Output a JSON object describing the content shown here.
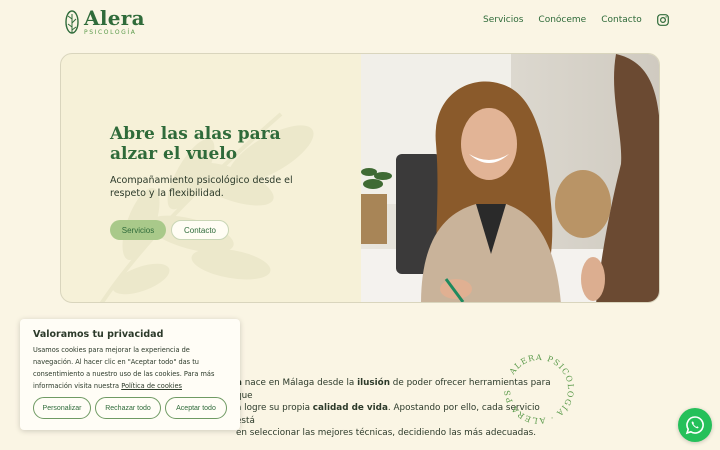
{
  "brand": {
    "name": "Alera",
    "tagline": "PSICOLOGÍA"
  },
  "nav": {
    "items": [
      {
        "label": "Servicios"
      },
      {
        "label": "Conóceme"
      },
      {
        "label": "Contacto"
      }
    ],
    "instagram_icon": "instagram-icon"
  },
  "hero": {
    "title_line1": "Abre las alas para",
    "title_line2": "alzar el vuelo",
    "subtitle": "Acompañamiento psicológico desde el respeto y la flexibilidad.",
    "primary_button": "Servicios",
    "secondary_button": "Contacto"
  },
  "intro": {
    "part1_bold": "a",
    "part2": " nace en Málaga desde la ",
    "part3_bold": "ilusión",
    "part4": " de poder ofrecer herramientas para que",
    "line2a": "a logre su propia ",
    "line2b_bold": "calidad de vida",
    "line2c": ". Apostando por ello, cada servicio está",
    "line3": "en seleccionar las mejores técnicas, decidiendo las más adecuadas."
  },
  "badge": {
    "text": "ALERA PSICOLOGÍA · ALERA PS"
  },
  "cookie": {
    "title": "Valoramos tu privacidad",
    "text": "Usamos cookies para mejorar la experiencia de navegación. Al hacer clic en \"Aceptar todo\" das tu consentimiento a nuestro uso de las cookies. Para más información visita nuestra ",
    "link": "Política de cookies",
    "buttons": {
      "customize": "Personalizar",
      "reject": "Rechazar todo",
      "accept": "Aceptar todo"
    }
  },
  "whatsapp": {
    "icon": "whatsapp-icon"
  },
  "colors": {
    "accent": "#2f6b3a",
    "light_green": "#a9c98a",
    "background": "#faf5e4",
    "whatsapp": "#25c05a"
  }
}
